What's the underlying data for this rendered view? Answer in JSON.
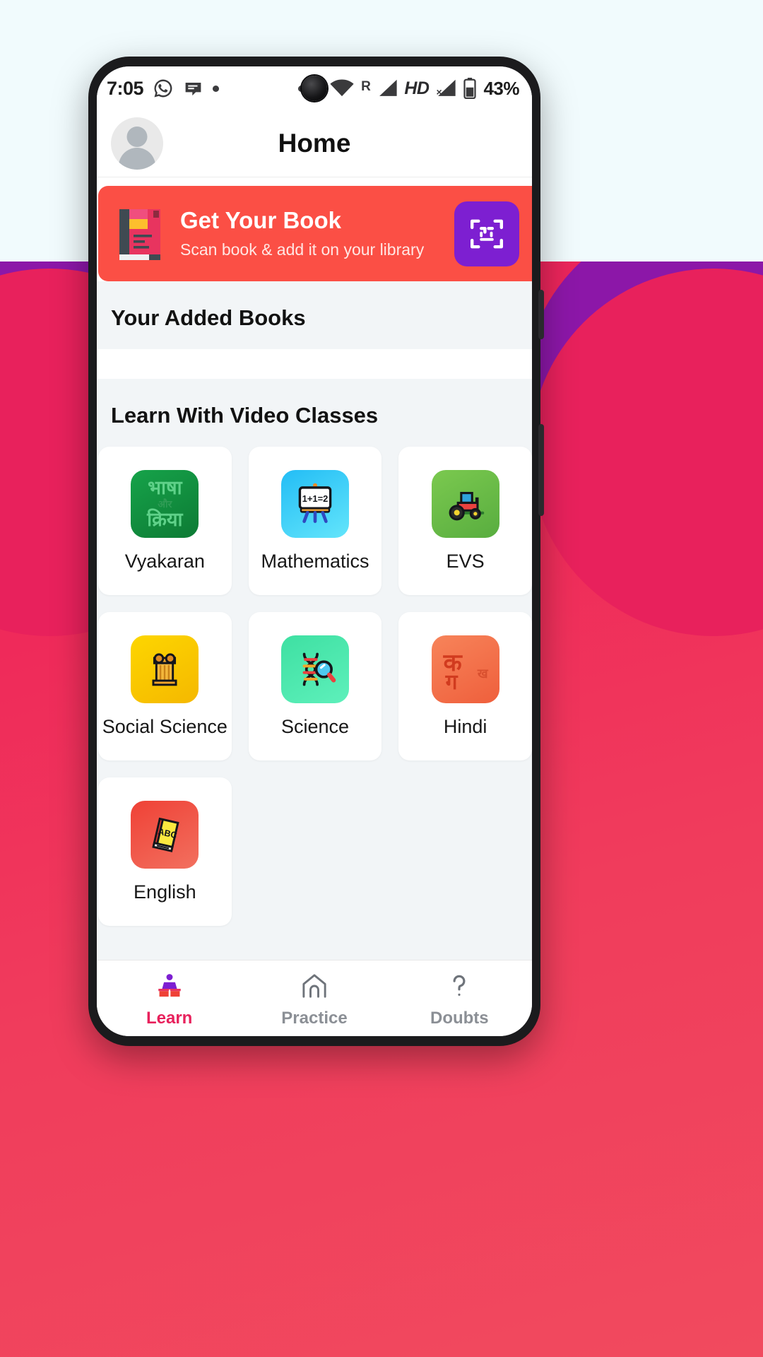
{
  "status_bar": {
    "time": "7:05",
    "icons_left": [
      "whatsapp-icon",
      "message-icon",
      "dot-icon"
    ],
    "icons_right": [
      "dot-icon",
      "data-transfer-icon",
      "wifi-icon",
      "roaming-R",
      "signal-icon",
      "HD",
      "signal-x-icon",
      "battery-icon"
    ],
    "roaming_label": "R",
    "wifi_label": "4",
    "hd_label": "HD",
    "battery_percent": "43%"
  },
  "app_bar": {
    "title": "Home",
    "avatar": "user-avatar"
  },
  "banner": {
    "title": "Get Your Book",
    "subtitle": "Scan book & add it on your library",
    "icon": "book-icon",
    "scan_icon": "scan-frame-icon",
    "bg_color": "#fb4f45",
    "scan_button_color": "#7d1fd1"
  },
  "sections": [
    {
      "title": "Your Added Books"
    },
    {
      "title": "Learn With Video Classes"
    }
  ],
  "subjects": [
    {
      "label": "Vyakaran",
      "icon": "hindi-grammar-icon",
      "tile_color": "#0f8a3c",
      "glyph_top": "भाषा",
      "glyph_bottom": "क्रिया"
    },
    {
      "label": "Mathematics",
      "icon": "whiteboard-icon",
      "tile_color": "#26c6f5",
      "equation": "1+1=2"
    },
    {
      "label": "EVS",
      "icon": "tractor-icon",
      "tile_color": "#6cc04a"
    },
    {
      "label": "Social Science",
      "icon": "pillar-icon",
      "tile_color": "#fcd200"
    },
    {
      "label": "Science",
      "icon": "dna-microscope-icon",
      "tile_color": "#3ddba0"
    },
    {
      "label": "Hindi",
      "icon": "devanagari-icon",
      "tile_color": "#f4704a",
      "glyph_main": "क",
      "glyph_sub": "ग",
      "glyph_small": "ख"
    },
    {
      "label": "English",
      "icon": "abc-book-icon",
      "tile_color": "#ef4136",
      "book_text": "ABC"
    }
  ],
  "bottom_nav": {
    "active_color": "#e8215c",
    "inactive_color": "#8b8f95",
    "items": [
      {
        "label": "Learn",
        "icon": "reading-person-icon",
        "active": true
      },
      {
        "label": "Practice",
        "icon": "home-arch-icon",
        "active": false
      },
      {
        "label": "Doubts",
        "icon": "question-mark-icon",
        "active": false
      }
    ]
  }
}
